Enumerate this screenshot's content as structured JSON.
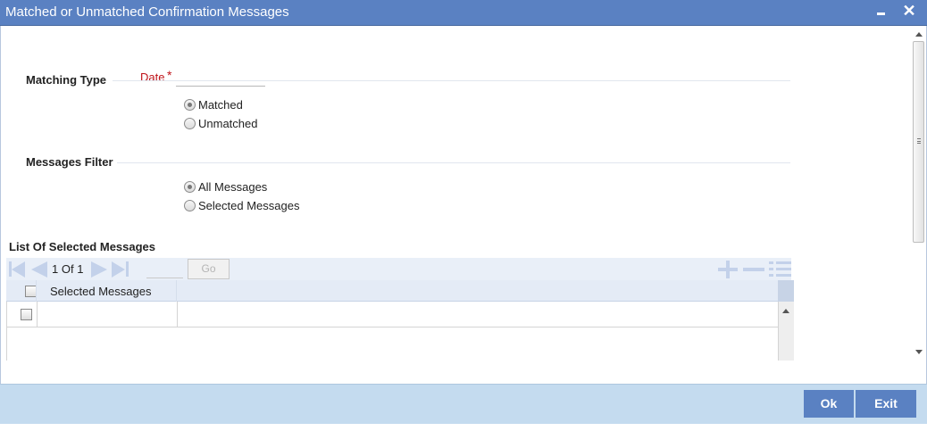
{
  "window": {
    "title": "Matched or Unmatched Confirmation Messages",
    "minimize_icon": "minimize-icon",
    "close_icon": "close-icon",
    "close_glyph": "✕"
  },
  "form": {
    "date_label": "Date",
    "required_marker": "*",
    "date_value": "",
    "matching_type": {
      "heading": "Matching Type",
      "options": [
        "Matched",
        "Unmatched"
      ],
      "selected": "Matched"
    },
    "messages_filter": {
      "heading": "Messages Filter",
      "options": [
        "All Messages",
        "Selected Messages"
      ],
      "selected": "All Messages"
    }
  },
  "list": {
    "heading": "List Of Selected Messages",
    "pager": {
      "current": "1",
      "of_label": "Of",
      "total": "1",
      "go_label": "Go",
      "page_input_value": ""
    },
    "columns": [
      "Selected Messages"
    ],
    "rows": [
      {
        "selected_message": ""
      }
    ]
  },
  "colors": {
    "title_bar": "#5a81c2",
    "footer": "#c4dbef",
    "required": "#c0141a",
    "button": "#5a81c2"
  },
  "footer": {
    "ok_label": "Ok",
    "exit_label": "Exit"
  }
}
